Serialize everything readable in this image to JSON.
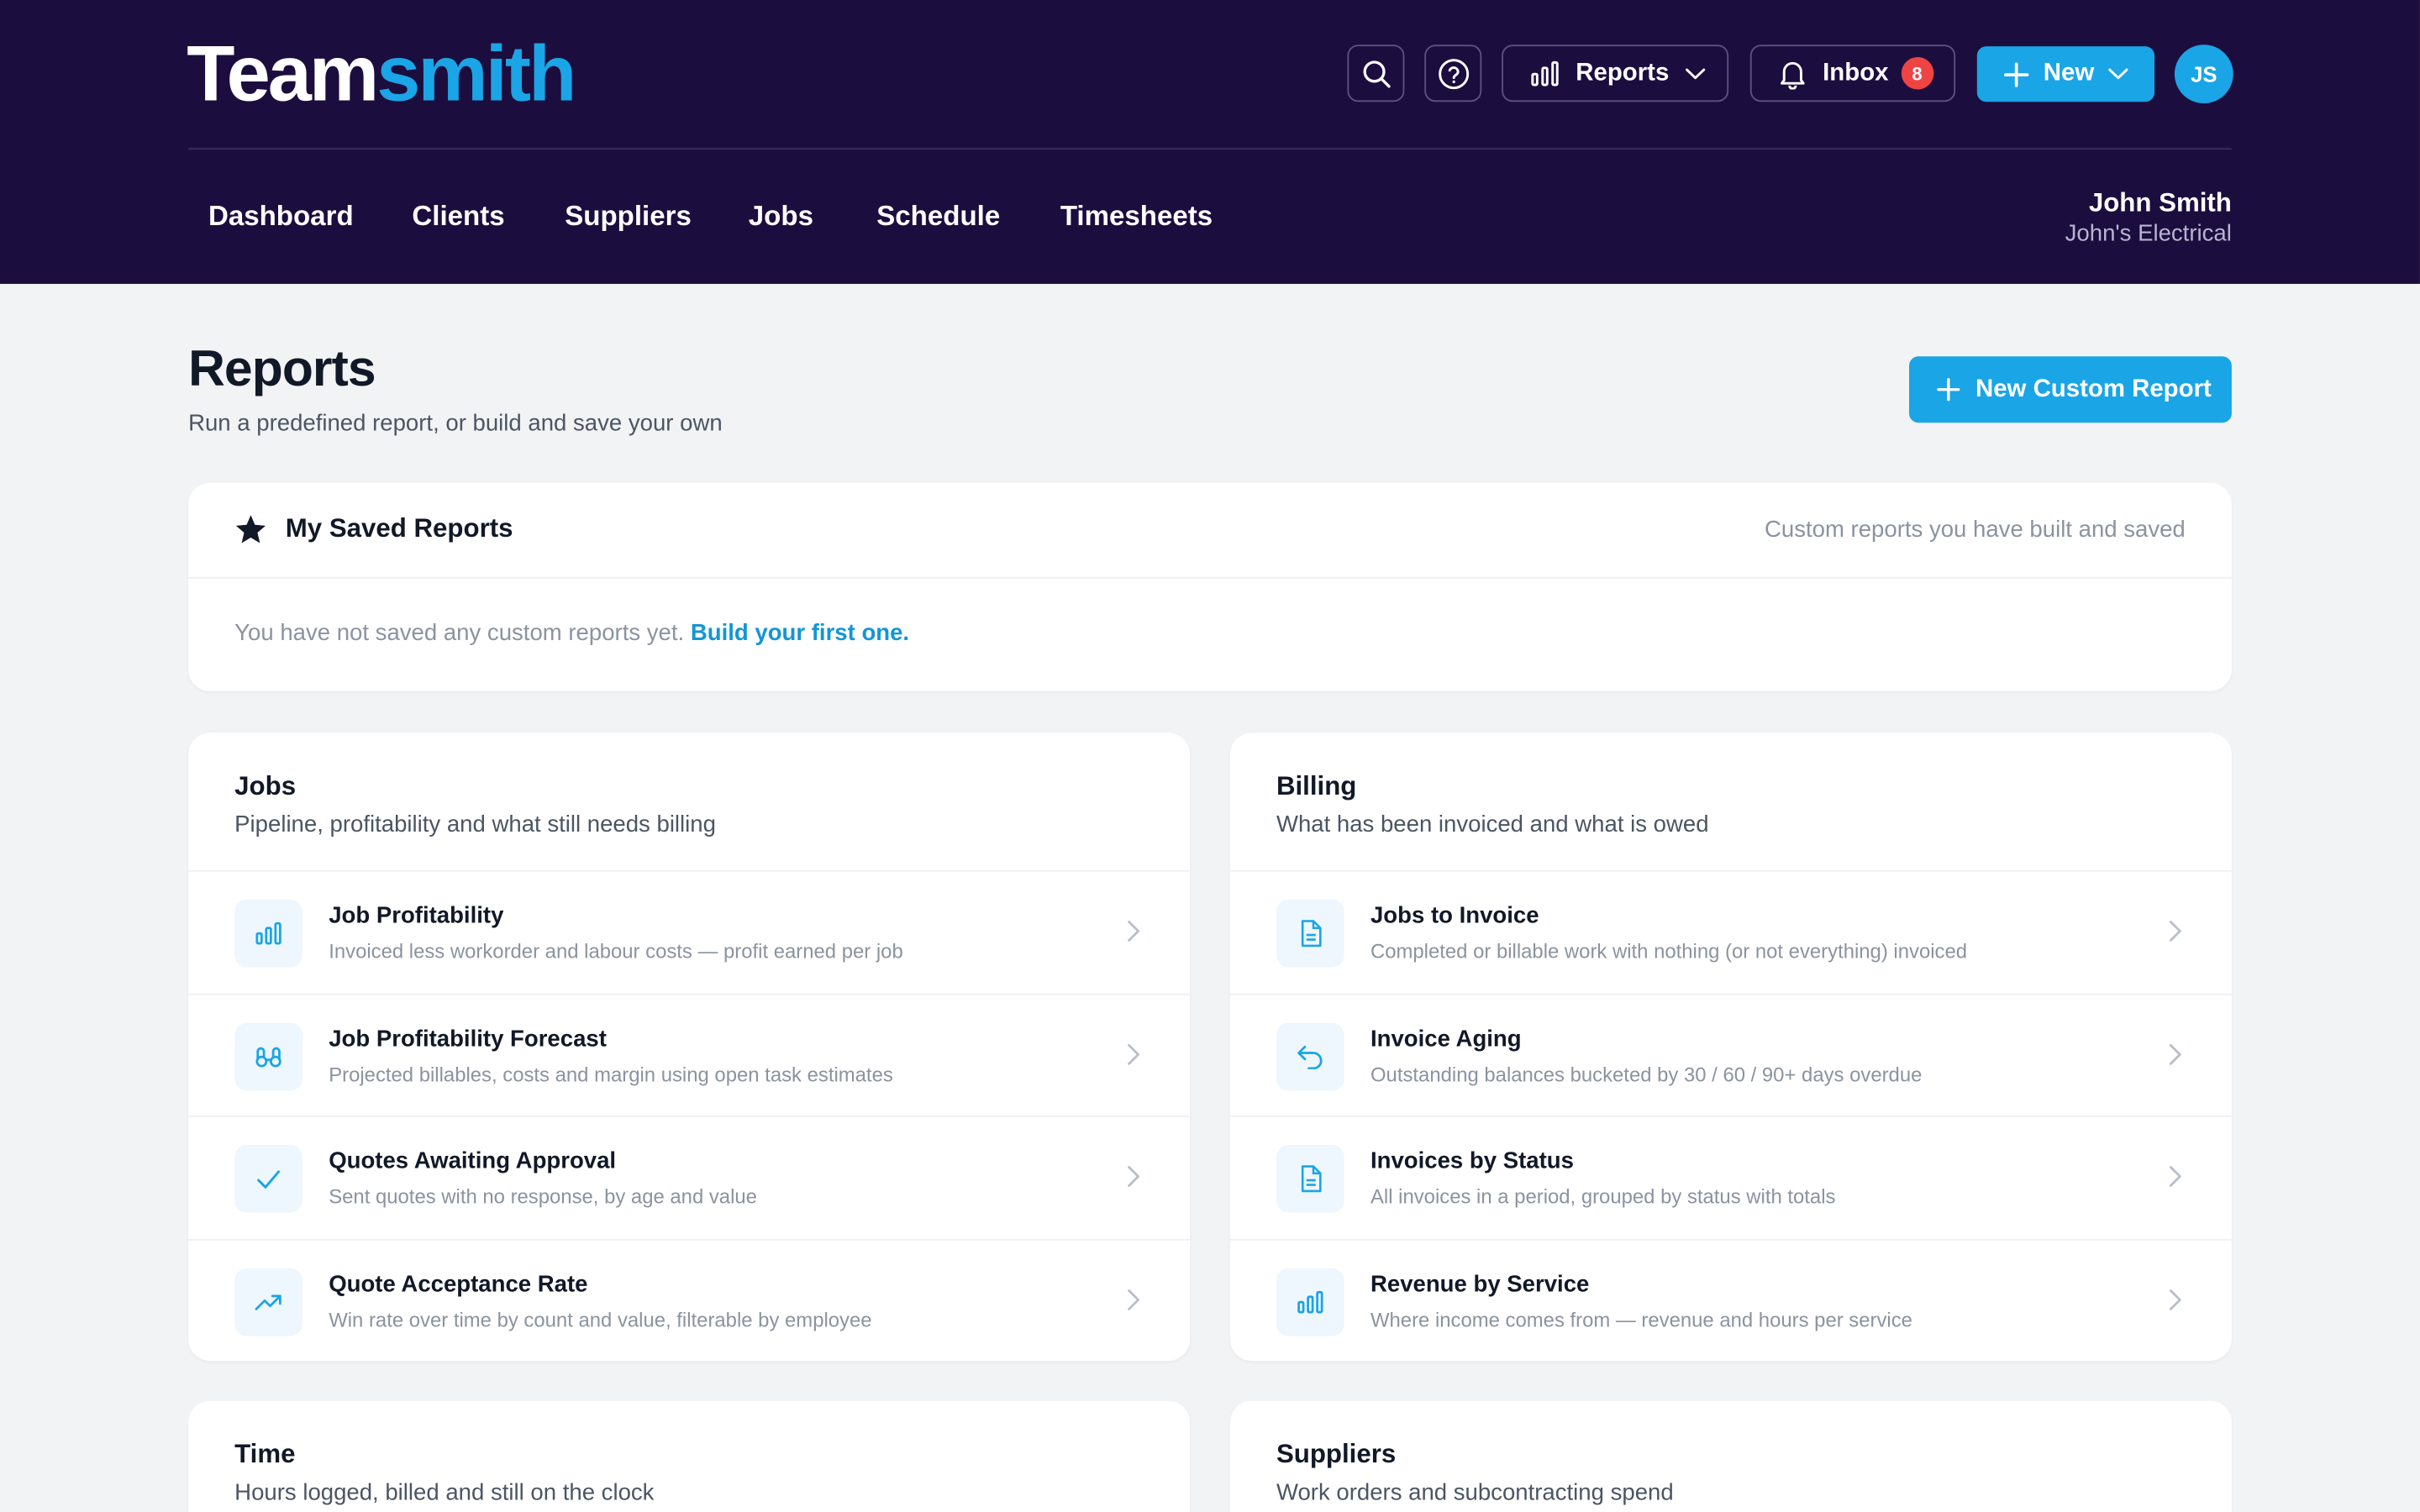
{
  "brand": {
    "part1": "Team",
    "part2": "smith"
  },
  "topbar": {
    "reports_label": "Reports",
    "inbox_label": "Inbox",
    "inbox_count": "8",
    "new_label": "New",
    "avatar_initials": "JS"
  },
  "nav": {
    "items": [
      "Dashboard",
      "Clients",
      "Suppliers",
      "Jobs",
      "Schedule",
      "Timesheets"
    ]
  },
  "user": {
    "name": "John Smith",
    "org": "John's Electrical"
  },
  "page": {
    "title": "Reports",
    "subtitle": "Run a predefined report, or build and save your own",
    "cta_label": "New Custom Report"
  },
  "saved": {
    "title": "My Saved Reports",
    "hint": "Custom reports you have built and saved",
    "empty_text": "You have not saved any custom reports yet.",
    "empty_link": "Build your first one."
  },
  "sections": {
    "jobs": {
      "title": "Jobs",
      "desc": "Pipeline, profitability and what still needs billing",
      "reports": [
        {
          "title": "Job Profitability",
          "desc": "Invoiced less workorder and labour costs — profit earned per job",
          "icon": "bar-chart-icon"
        },
        {
          "title": "Job Profitability Forecast",
          "desc": "Projected billables, costs and margin using open task estimates",
          "icon": "binoculars-icon"
        },
        {
          "title": "Quotes Awaiting Approval",
          "desc": "Sent quotes with no response, by age and value",
          "icon": "check-icon"
        },
        {
          "title": "Quote Acceptance Rate",
          "desc": "Win rate over time by count and value, filterable by employee",
          "icon": "trend-up-icon"
        }
      ]
    },
    "billing": {
      "title": "Billing",
      "desc": "What has been invoiced and what is owed",
      "reports": [
        {
          "title": "Jobs to Invoice",
          "desc": "Completed or billable work with nothing (or not everything) invoiced",
          "icon": "document-icon"
        },
        {
          "title": "Invoice Aging",
          "desc": "Outstanding balances bucketed by 30 / 60 / 90+ days overdue",
          "icon": "undo-arrow-icon"
        },
        {
          "title": "Invoices by Status",
          "desc": "All invoices in a period, grouped by status with totals",
          "icon": "document-icon"
        },
        {
          "title": "Revenue by Service",
          "desc": "Where income comes from — revenue and hours per service",
          "icon": "bar-chart-icon"
        }
      ]
    },
    "time": {
      "title": "Time",
      "desc": "Hours logged, billed and still on the clock"
    },
    "suppliers": {
      "title": "Suppliers",
      "desc": "Work orders and subcontracting spend"
    }
  },
  "colors": {
    "header_bg": "#1c0d3f",
    "accent": "#1aa5e6",
    "badge": "#ef4444",
    "page_bg": "#f2f3f5"
  }
}
